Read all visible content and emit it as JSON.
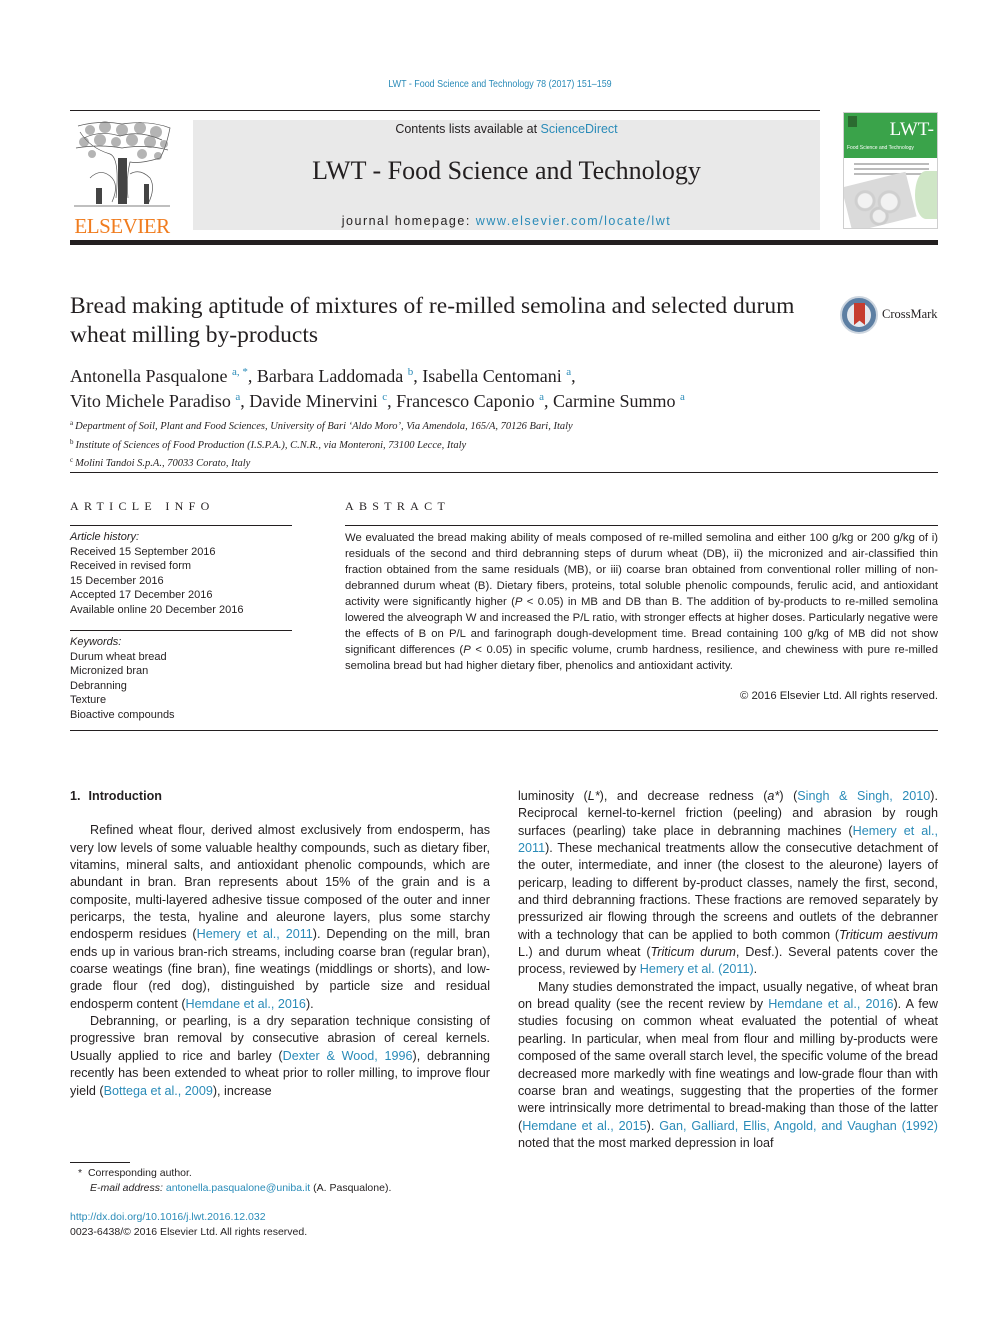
{
  "header": {
    "journal_ref": "LWT - Food Science and Technology 78 (2017) 151–159",
    "contents_prefix": "Contents lists available at ",
    "contents_link": "ScienceDirect",
    "journal_title": "LWT - Food Science and Technology",
    "homepage_prefix": "journal homepage: ",
    "homepage_link": "www.elsevier.com/locate/lwt",
    "publisher_logo_text": "ELSEVIER",
    "cover": {
      "title": "LWT-",
      "subtitle": "Food Science and Technology"
    }
  },
  "article": {
    "title": "Bread making aptitude of mixtures of re-milled semolina and selected durum wheat milling by-products",
    "crossmark_label": "CrossMark",
    "authors": [
      {
        "name": "Antonella Pasqualone",
        "sup": "a, *",
        "sep": ", "
      },
      {
        "name": "Barbara Laddomada",
        "sup": "b",
        "sep": ", "
      },
      {
        "name": "Isabella Centomani",
        "sup": "a",
        "sep": ","
      },
      {
        "name": "Vito Michele Paradiso",
        "sup": "a",
        "sep": ", "
      },
      {
        "name": "Davide Minervini",
        "sup": "c",
        "sep": ", "
      },
      {
        "name": "Francesco Caponio",
        "sup": "a",
        "sep": ", "
      },
      {
        "name": "Carmine Summo",
        "sup": "a",
        "sep": ""
      }
    ],
    "affiliations": [
      {
        "key": "a",
        "text": "Department of Soil, Plant and Food Sciences, University of Bari ‘Aldo Moro’, Via Amendola, 165/A, 70126 Bari, Italy"
      },
      {
        "key": "b",
        "text": "Institute of Sciences of Food Production (I.S.P.A.), C.N.R., via Monteroni, 73100 Lecce, Italy"
      },
      {
        "key": "c",
        "text": "Molini Tandoi S.p.A., 70033 Corato, Italy"
      }
    ]
  },
  "article_info": {
    "heading": "ARTICLE INFO",
    "history_label": "Article history:",
    "history": [
      "Received 15 September 2016",
      "Received in revised form",
      "15 December 2016",
      "Accepted 17 December 2016",
      "Available online 20 December 2016"
    ],
    "keywords_label": "Keywords:",
    "keywords": [
      "Durum wheat bread",
      "Micronized bran",
      "Debranning",
      "Texture",
      "Bioactive compounds"
    ]
  },
  "abstract": {
    "heading": "ABSTRACT",
    "parts": {
      "p1": "We evaluated the bread making ability of meals composed of re-milled semolina and either 100 g/kg or 200 g/kg of i) residuals of the second and third debranning steps of durum wheat (DB), ii) the micronized and air-classified thin fraction obtained from the same residuals (MB), or iii) coarse bran obtained from conventional roller milling of non-debranned durum wheat (B). Dietary fibers, proteins, total soluble phenolic compounds, ferulic acid, and antioxidant activity were significantly higher (",
      "p_italic1": "P",
      "p2": " < 0.05) in MB and DB than B. The addition of by-products to re-milled semolina lowered the alveograph W and increased the P/L ratio, with stronger effects at higher doses. Particularly negative were the effects of B on P/L and farinograph dough-development time. Bread containing 100 g/kg of MB did not show significant differences (",
      "p_italic2": "P",
      "p3": " < 0.05) in specific volume, crumb hardness, resilience, and chewiness with pure re-milled semolina bread but had higher dietary fiber, phenolics and antioxidant activity."
    },
    "copyright": "© 2016 Elsevier Ltd. All rights reserved."
  },
  "body": {
    "section_number": "1.",
    "section_title": "Introduction",
    "left": {
      "p1_a": "Refined wheat flour, derived almost exclusively from endosperm, has very low levels of some valuable healthy compounds, such as dietary fiber, vitamins, mineral salts, and antioxidant phenolic compounds, which are abundant in bran. Bran represents about 15% of the grain and is a composite, multi-layered adhesive tissue composed of the outer and inner pericarps, the testa, hyaline and aleurone layers, plus some starchy endosperm residues (",
      "p1_cite1": "Hemery et al., 2011",
      "p1_b": "). Depending on the mill, bran ends up in various bran-rich streams, including coarse bran (regular bran), coarse weatings (fine bran), fine weatings (middlings or shorts), and low-grade flour (red dog), distinguished by particle size and residual endosperm content (",
      "p1_cite2": "Hemdane et al., 2016",
      "p1_c": ").",
      "p2_a": "Debranning, or pearling, is a dry separation technique consisting of progressive bran removal by consecutive abrasion of cereal kernels. Usually applied to rice and barley (",
      "p2_cite1": "Dexter & Wood, 1996",
      "p2_b": "), debranning recently has been extended to wheat prior to roller milling, to improve flour yield (",
      "p2_cite2": "Bottega et al., 2009",
      "p2_c": "), increase"
    },
    "right": {
      "p1_a": "luminosity (",
      "p1_i1": "L*",
      "p1_b": "), and decrease redness (",
      "p1_i2": "a*",
      "p1_c": ") (",
      "p1_cite1": "Singh & Singh, 2010",
      "p1_d": "). Reciprocal kernel-to-kernel friction (peeling) and abrasion by rough surfaces (pearling) take place in debranning machines (",
      "p1_cite2": "Hemery et al., 2011",
      "p1_e": "). These mechanical treatments allow the consecutive detachment of the outer, intermediate, and inner (the closest to the aleurone) layers of pericarp, leading to different by-product classes, namely the first, second, and third debranning fractions. These fractions are removed separately by pressurized air flowing through the screens and outlets of the debranner with a technology that can be applied to both common (",
      "p1_i3": "Triticum aestivum",
      "p1_f": " L.) and durum wheat (",
      "p1_i4": "Triticum durum",
      "p1_g": ", Desf.). Several patents cover the process, reviewed by ",
      "p1_cite3": "Hemery et al. (2011)",
      "p1_h": ".",
      "p2_a": "Many studies demonstrated the impact, usually negative, of wheat bran on bread quality (see the recent review by ",
      "p2_cite1": "Hemdane et al., 2016",
      "p2_b": "). A few studies focusing on common wheat evaluated the potential of wheat pearling. In particular, when meal from flour and milling by-products were composed of the same overall starch level, the specific volume of the bread decreased more markedly with fine weatings and low-grade flour than with coarse bran and weatings, suggesting that the properties of the former were intrinsically more detrimental to bread-making than those of the latter (",
      "p2_cite2": "Hemdane et al., 2015",
      "p2_c": "). ",
      "p2_cite3": "Gan, Galliard, Ellis, Angold, and Vaughan (1992)",
      "p2_d": " noted that the most marked depression in loaf"
    }
  },
  "footnotes": {
    "star": "*",
    "corresponding": "Corresponding author.",
    "email_label": "E-mail address:",
    "email": "antonella.pasqualone@uniba.it",
    "email_suffix": " (A. Pasqualone).",
    "doi": "http://dx.doi.org/10.1016/j.lwt.2016.12.032",
    "issn_line": "0023-6438/© 2016 Elsevier Ltd. All rights reserved."
  }
}
